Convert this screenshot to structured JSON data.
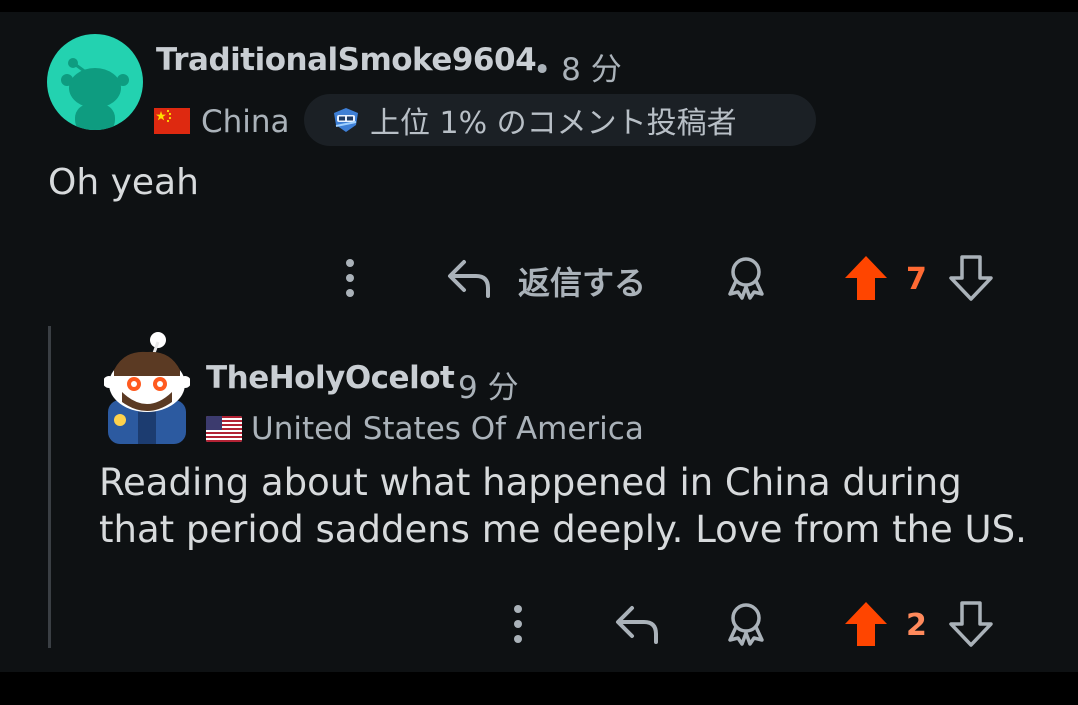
{
  "comment": {
    "username": "TraditionalSmoke9604",
    "time": "• 8 分",
    "flair_country": "China",
    "badge_label": "上位 1% のコメント投稿者",
    "body": "Oh yeah",
    "reply_label": "返信する",
    "vote_count": "7",
    "colors": {
      "upvote": "#ff4500",
      "avatar_bg": "#23d2b0"
    }
  },
  "reply": {
    "username": "TheHolyOcelot",
    "time": "9 分",
    "flair_country": "United States Of America",
    "body_line1": "Reading about what happened in China during",
    "body_line2": "that period saddens me deeply. Love from the US.",
    "vote_count": "2"
  },
  "icons": [
    "more-vertical-icon",
    "reply-icon",
    "award-icon",
    "upvote-icon",
    "downvote-icon",
    "badge-icon",
    "flag-cn-icon",
    "flag-us-icon"
  ]
}
